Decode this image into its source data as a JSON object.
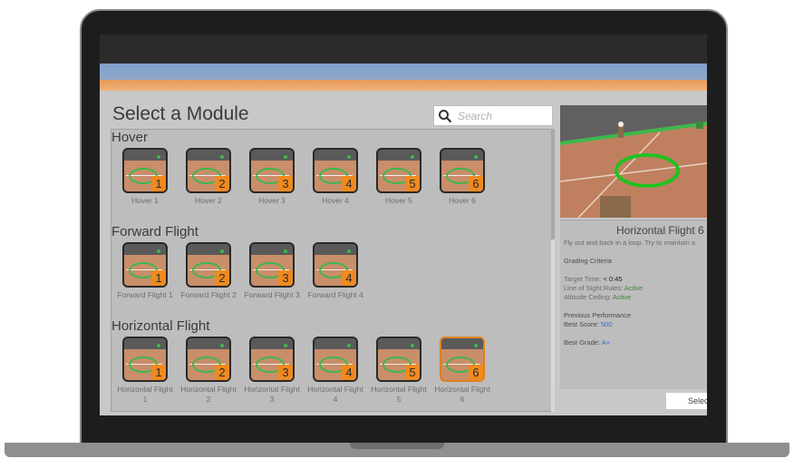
{
  "page": {
    "heading": "Select a Module",
    "search_placeholder": "Search"
  },
  "groups": [
    {
      "title": "Hover",
      "tiles": [
        {
          "num": "1",
          "label": "Hover 1"
        },
        {
          "num": "2",
          "label": "Hover 2"
        },
        {
          "num": "3",
          "label": "Hover 3"
        },
        {
          "num": "4",
          "label": "Hover 4"
        },
        {
          "num": "5",
          "label": "Hover 5"
        },
        {
          "num": "6",
          "label": "Hover 6"
        }
      ]
    },
    {
      "title": "Forward Flight",
      "tiles": [
        {
          "num": "1",
          "label": "Forward Flight 1"
        },
        {
          "num": "2",
          "label": "Forward Flight 2"
        },
        {
          "num": "3",
          "label": "Forward Flight 3"
        },
        {
          "num": "4",
          "label": "Forward Flight 4"
        }
      ]
    },
    {
      "title": "Horizontal Flight",
      "tiles": [
        {
          "num": "1",
          "label": "Horizontal Flight 1"
        },
        {
          "num": "2",
          "label": "Horizontal Flight 2"
        },
        {
          "num": "3",
          "label": "Horizontal Flight 3"
        },
        {
          "num": "4",
          "label": "Horizontal Flight 4"
        },
        {
          "num": "5",
          "label": "Horizontal Flight 5"
        },
        {
          "num": "6",
          "label": "Horizontal Flight 6",
          "selected": true
        }
      ]
    }
  ],
  "details": {
    "title": "Horizontal Flight 6",
    "description": "Fly out and back in a loop. Try to maintain a",
    "grading_header": "Grading Criteria",
    "target_time_label": "Target Time:",
    "target_time_value": "< 0:45",
    "los_label": "Line of Sight Rules:",
    "los_value": "Active",
    "alt_label": "Altitude Ceiling:",
    "alt_value": "Active",
    "prev_header": "Previous Performance",
    "best_score_label": "Best Score:",
    "best_score_value": "500",
    "best_grade_label": "Best Grade:",
    "best_grade_value": "A+"
  },
  "select_button": "Selec",
  "colors": {
    "accent_orange": "#f08a1e",
    "ring_green": "#3db84a",
    "active_green": "#2f8e2f",
    "score_blue": "#2a6ed8"
  }
}
